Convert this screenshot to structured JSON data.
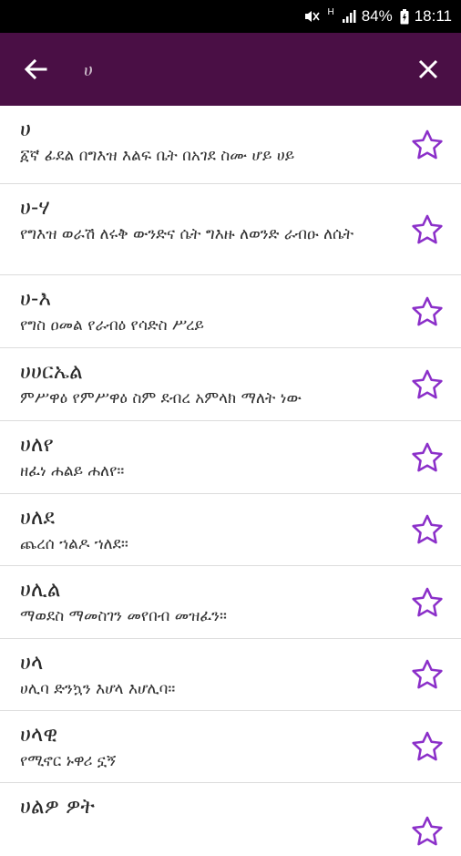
{
  "status_bar": {
    "h_indicator": "H",
    "battery": "84%",
    "time": "18:11"
  },
  "app_bar": {
    "search_value": "ሀ",
    "background": "#4a0f45"
  },
  "accent_color": "#8b2fc9",
  "entries": [
    {
      "word": "ሀ",
      "definition": "፩ኛ ፊደል በግእዝ እልፍ ቤት በአገደ ስሙ ሆይ ሀይ"
    },
    {
      "word": "ሀ-ሃ",
      "definition": "የግእዝ ወራሽ ለሩቅ ውንድና ሴት ግእዙ ለወንድ ራብዑ ለሴት"
    },
    {
      "word": "ሀ-እ",
      "definition": "የግስ ዐመል የራብዕ የሳድስ ሥረይ"
    },
    {
      "word": "ሀሀርኤል",
      "definition": "ምሥዋዕ የምሥዋዕ ስም ደብረ አምላክ ማለት ነው"
    },
    {
      "word": "ሀለየ",
      "definition": "ዘፈነ ሐልይ ሐለየ።"
    },
    {
      "word": "ሀለደ",
      "definition": "ጨረሰ ኀልዶ ኀለደ።"
    },
    {
      "word": "ሀሊል",
      "definition": "ማወደስ ማመስገን መየበብ መዝፈን።"
    },
    {
      "word": "ሀላ",
      "definition": "ሀሊባ ድንኳን እሆላ እሆሊባ።"
    },
    {
      "word": "ሀላዊ",
      "definition": "የሚኖር ኑዋሪ ኗኝ"
    },
    {
      "word": "ሀልዎ ዎት",
      "definition": ""
    }
  ]
}
